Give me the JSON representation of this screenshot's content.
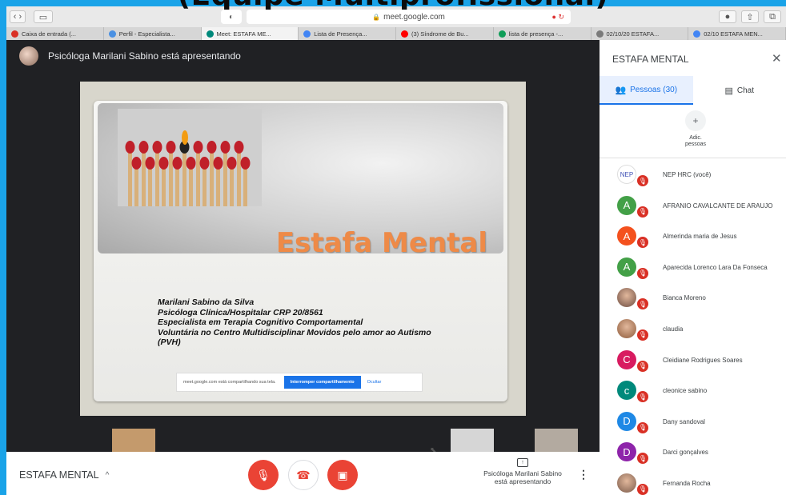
{
  "overlay": {
    "text": "(Equipe Multiprofissional)"
  },
  "browser": {
    "url": "meet.google.com",
    "tabs": [
      {
        "label": "Caixa de entrada (...",
        "color": "#d93025"
      },
      {
        "label": "Perfil - Especialista...",
        "color": "#4a90e2"
      },
      {
        "label": "Meet: ESTAFA ME...",
        "color": "#00897b",
        "active": true
      },
      {
        "label": "Lista de Presença...",
        "color": "#4285f4"
      },
      {
        "label": "(3) Síndrome de Bu...",
        "color": "#ff0000"
      },
      {
        "label": "lista de presença -...",
        "color": "#0f9d58"
      },
      {
        "label": "02/10/20 ESTAFA...",
        "color": "#7a7a7a"
      },
      {
        "label": "02/10 ESTAFA MEN...",
        "color": "#4285f4"
      }
    ]
  },
  "meet": {
    "presenter_text": "Psicóloga Marilani Sabino está apresentando",
    "slide": {
      "title": "Estafa Mental",
      "lines": [
        "Marilani Sabino da Silva",
        "Psicóloga Clínica/Hospitalar CRP 20/8561",
        "Especialista em Terapia Cognitivo Comportamental",
        "Voluntária no Centro Multidisciplinar Movidos pelo amor ao Autismo",
        "(PVH)"
      ],
      "share_text": "meet.google.com está compartilhando sua tela.",
      "stop_label": "Interromper compartilhamento",
      "hide_label": "Ocultar"
    },
    "meeting_name": "ESTAFA MENTAL",
    "present_label_1": "Psicóloga Marilani Sabino",
    "present_label_2": "está apresentando"
  },
  "panel": {
    "title": "ESTAFA MENTAL",
    "tab_people": "Pessoas (30)",
    "tab_chat": "Chat",
    "add_label_1": "Adic.",
    "add_label_2": "pessoas",
    "people": [
      {
        "name": "NEP HRC (você)",
        "initial": "NEP",
        "color": "#ffffff"
      },
      {
        "name": "AFRANIO CAVALCANTE DE ARAUJO",
        "initial": "A",
        "color": "#43a047"
      },
      {
        "name": "Almerinda maria de Jesus",
        "initial": "A",
        "color": "#f4511e"
      },
      {
        "name": "Aparecida Lorenco Lara Da Fonseca",
        "initial": "A",
        "color": "#43a047"
      },
      {
        "name": "Bianca Moreno",
        "initial": "",
        "color": "#6d4c41"
      },
      {
        "name": "claudia",
        "initial": "",
        "color": "#8d5a3a"
      },
      {
        "name": "Cleidiane Rodrigues Soares",
        "initial": "C",
        "color": "#d81b60"
      },
      {
        "name": "cleonice sabino",
        "initial": "c",
        "color": "#00897b"
      },
      {
        "name": "Dany sandoval",
        "initial": "D",
        "color": "#1e88e5"
      },
      {
        "name": "Darci gonçalves",
        "initial": "D",
        "color": "#8e24aa"
      },
      {
        "name": "Fernanda Rocha",
        "initial": "",
        "color": "#7a5a4a"
      }
    ]
  }
}
